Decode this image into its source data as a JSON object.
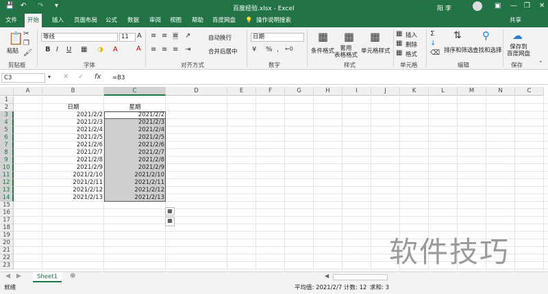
{
  "app": {
    "title": "百度经验.xlsx  -  Excel",
    "user": "阳 李"
  },
  "tabs": [
    "文件",
    "开始",
    "插入",
    "页面布局",
    "公式",
    "数据",
    "审阅",
    "视图",
    "帮助",
    "百度网盘"
  ],
  "tell_me": "操作说明搜索",
  "share": "共享",
  "ribbon": {
    "paste": "粘贴",
    "clipboard": "剪贴板",
    "font_name": "等线",
    "font_size": "11",
    "font_label": "字体",
    "wrap": "自动换行",
    "merge": "合并后居中",
    "alignment_label": "对齐方式",
    "num_format": "日期",
    "number_label": "数字",
    "cond_format": "条件格式",
    "table_format": "套用\n表格格式",
    "cell_style": "单元格样式",
    "styles_label": "样式",
    "insert": "插入",
    "delete": "删除",
    "format": "格式",
    "cells_label": "单元格",
    "sort_filter": "排序和筛选",
    "find_select": "查找和选择",
    "editing_label": "编辑",
    "save_to": "保存到\n百度网盘",
    "save_label": "保存"
  },
  "formula": {
    "namebox": "C3",
    "content": "=B3"
  },
  "columns": [
    "A",
    "B",
    "C",
    "D",
    "E",
    "F",
    "G",
    "H",
    "I",
    "J",
    "K",
    "L",
    "M",
    "N",
    "C"
  ],
  "rows": [
    "1",
    "2",
    "3",
    "4",
    "5",
    "6",
    "7",
    "8",
    "9",
    "10",
    "11",
    "12",
    "13",
    "14",
    "15",
    "16",
    "17",
    "18",
    "19",
    "20",
    "21",
    "22",
    "23"
  ],
  "headers": {
    "b": "日期",
    "c": "星期"
  },
  "b_values": [
    "2021/2/2",
    "2021/2/3",
    "2021/2/4",
    "2021/2/5",
    "2021/2/6",
    "2021/2/7",
    "2021/2/8",
    "2021/2/9",
    "2021/2/10",
    "2021/2/11",
    "2021/2/12",
    "2021/2/13"
  ],
  "c_values": [
    "2021/2/2",
    "2021/2/3",
    "2021/2/4",
    "2021/2/5",
    "2021/2/6",
    "2021/2/7",
    "2021/2/8",
    "2021/2/9",
    "2021/2/10",
    "2021/2/11",
    "2021/2/12",
    "2021/2/13"
  ],
  "sheet": "Sheet1",
  "status": {
    "ready": "就绪",
    "average": "平均值: 2021/2/7",
    "count": "计数: 12",
    "sum": "求和: 3"
  },
  "watermark": "软件技巧",
  "colors": {
    "accent": "#217346",
    "selection": "#cfcfcf"
  }
}
